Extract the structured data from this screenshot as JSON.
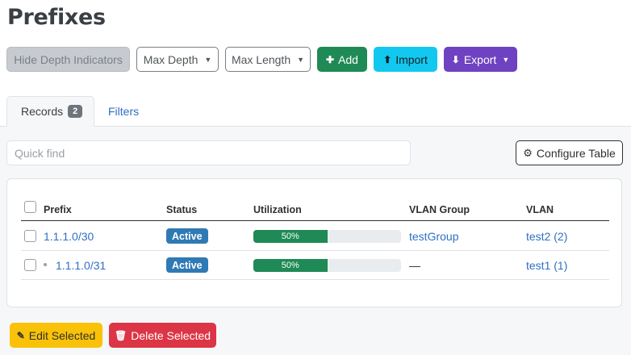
{
  "page": {
    "title": "Prefixes"
  },
  "toolbar": {
    "hide_depth": "Hide Depth Indicators",
    "max_depth": "Max Depth",
    "max_length": "Max Length",
    "add": "Add",
    "import": "Import",
    "export": "Export"
  },
  "tabs": {
    "records_label": "Records",
    "records_count": "2",
    "filters_label": "Filters"
  },
  "search": {
    "placeholder": "Quick find"
  },
  "configure_table": "Configure Table",
  "table": {
    "headers": {
      "prefix": "Prefix",
      "status": "Status",
      "utilization": "Utilization",
      "vlan_group": "VLAN Group",
      "vlan": "VLAN"
    },
    "rows": [
      {
        "prefix": "1.1.1.0/30",
        "status": "Active",
        "utilization": "50%",
        "utilization_value": 50,
        "vlan_group": "testGroup",
        "vlan": "test2 (2)"
      },
      {
        "prefix": "1.1.1.0/31",
        "status": "Active",
        "utilization": "50%",
        "utilization_value": 50,
        "vlan_group": "—",
        "vlan": "test1 (1)"
      }
    ]
  },
  "bulk": {
    "edit": "Edit Selected",
    "delete": "Delete Selected"
  },
  "colors": {
    "success": "#1f8a55",
    "info": "#13c8ee",
    "purple": "#6f42c1",
    "warning": "#f9c208",
    "danger": "#dc3545",
    "status_active": "#2f7ab5",
    "link": "#2f6fc4"
  },
  "icons": {
    "add": "plus-icon",
    "import": "upload-icon",
    "export": "download-icon",
    "configure": "gear-icon",
    "edit": "pencil-icon",
    "delete": "trash-icon"
  }
}
